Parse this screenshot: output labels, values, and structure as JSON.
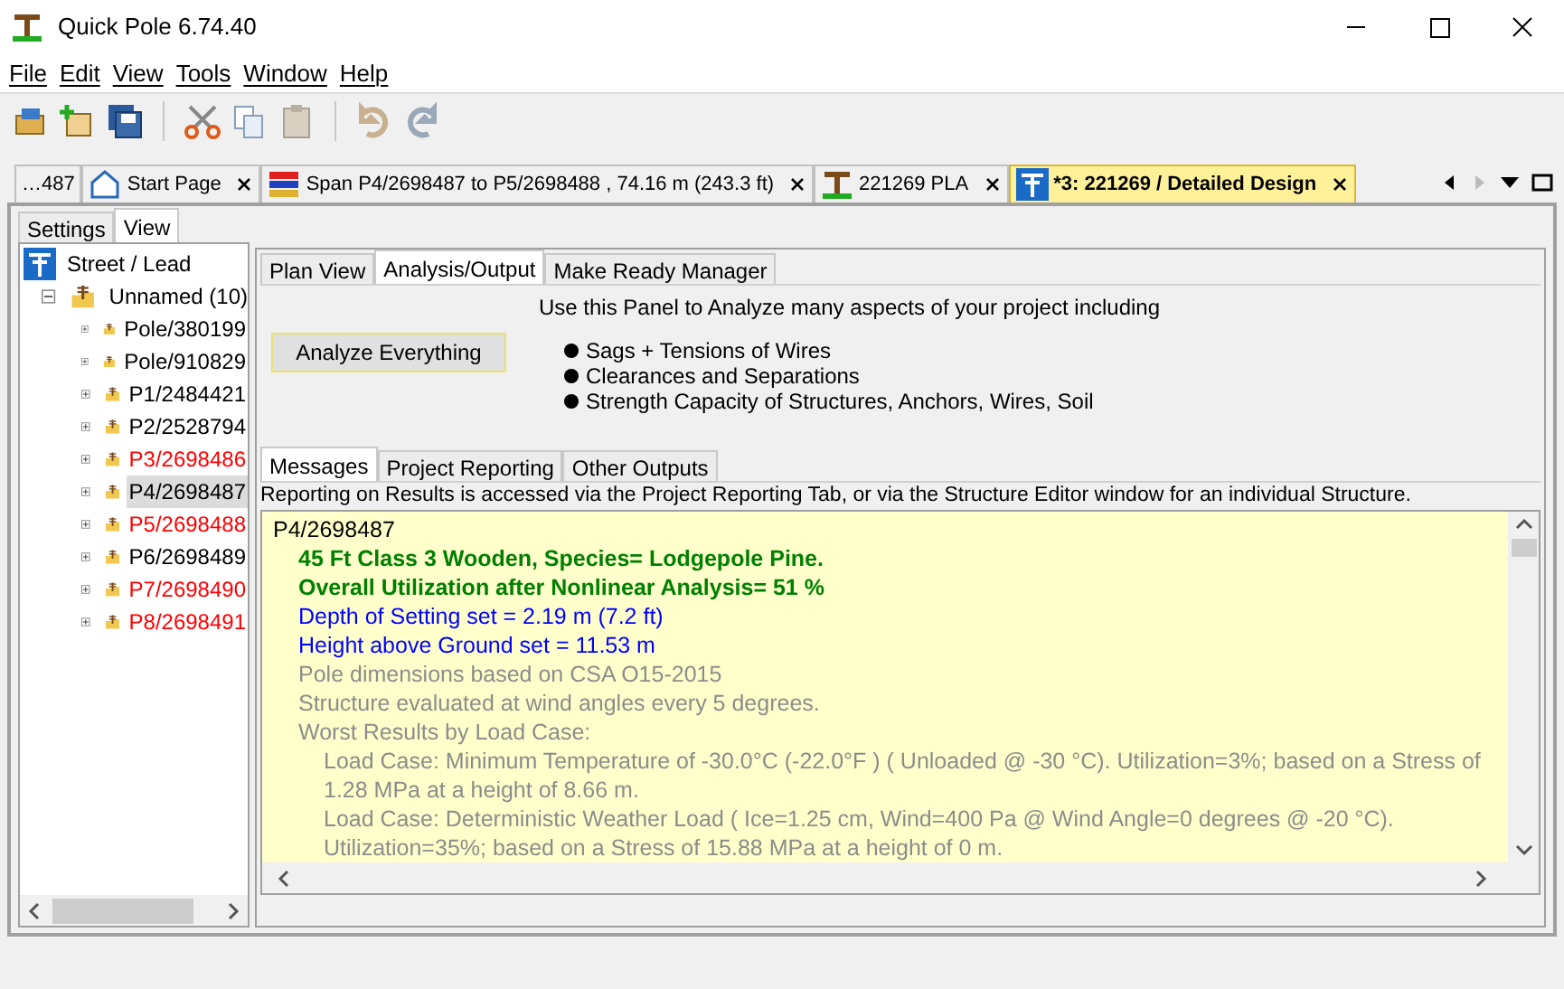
{
  "window": {
    "title": "Quick Pole 6.74.40"
  },
  "menu": [
    "File",
    "Edit",
    "View",
    "Tools",
    "Window",
    "Help"
  ],
  "doc_tabs": [
    {
      "label": "…487",
      "selected": false
    },
    {
      "label": "Start Page",
      "selected": false
    },
    {
      "label": "Span P4/2698487 to P5/2698488 , 74.16 m (243.3 ft)",
      "selected": false
    },
    {
      "label": "221269 PLA",
      "selected": false
    },
    {
      "label": "*3: 221269 / Detailed Design",
      "selected": true
    }
  ],
  "side_tabs": [
    {
      "label": "Settings",
      "selected": false
    },
    {
      "label": "View",
      "selected": true
    }
  ],
  "tree": {
    "label": "Street / Lead",
    "children": [
      {
        "label": "Unnamed (10)",
        "expanded": true,
        "children": [
          {
            "label": "Pole/380199",
            "color": "#000000",
            "selected": false
          },
          {
            "label": "Pole/910829",
            "color": "#000000",
            "selected": false
          },
          {
            "label": "P1/2484421",
            "color": "#000000",
            "selected": false
          },
          {
            "label": "P2/2528794",
            "color": "#000000",
            "selected": false
          },
          {
            "label": "P3/2698486",
            "color": "#ff0000",
            "selected": false
          },
          {
            "label": "P4/2698487",
            "color": "#000000",
            "selected": true
          },
          {
            "label": "P5/2698488",
            "color": "#ff0000",
            "selected": false
          },
          {
            "label": "P6/2698489",
            "color": "#000000",
            "selected": false
          },
          {
            "label": "P7/2698490",
            "color": "#ff0000",
            "selected": false
          },
          {
            "label": "P8/2698491",
            "color": "#ff0000",
            "selected": false
          }
        ]
      }
    ]
  },
  "main_tabs": [
    {
      "label": "Plan View",
      "selected": false
    },
    {
      "label": "Analysis/Output",
      "selected": true
    },
    {
      "label": "Make Ready Manager",
      "selected": false
    }
  ],
  "analysis": {
    "intro": "Use this Panel to Analyze many aspects of your project including",
    "button": "Analyze Everything",
    "bullets": [
      "Sags + Tensions of Wires",
      "Clearances and Separations",
      "Strength Capacity of Structures, Anchors, Wires, Soil"
    ]
  },
  "output_tabs": [
    {
      "label": "Messages",
      "selected": true
    },
    {
      "label": "Project Reporting",
      "selected": false
    },
    {
      "label": "Other Outputs",
      "selected": false
    }
  ],
  "reporting_note": "Reporting on Results is accessed via the Project Reporting Tab, or via the Structure Editor window for an individual Structure.",
  "messages": [
    {
      "kind": "heading",
      "text": "P4/2698487"
    },
    {
      "kind": "result",
      "text": "45 Ft Class 3 Wooden, Species= Lodgepole Pine."
    },
    {
      "kind": "result",
      "text": "Overall Utilization after Nonlinear Analysis= 51 %"
    },
    {
      "kind": "setting",
      "text": "Depth of Setting set = 2.19 m (7.2 ft)"
    },
    {
      "kind": "setting",
      "text": "Height above Ground set = 11.53 m"
    },
    {
      "kind": "info",
      "text": "Pole dimensions based on CSA O15-2015"
    },
    {
      "kind": "info",
      "text": "Structure evaluated at wind angles every 5 degrees."
    },
    {
      "kind": "info",
      "text": "Worst Results by Load Case:"
    },
    {
      "kind": "case",
      "text": "Load Case: Minimum Temperature of -30.0°C (-22.0°F ) ( Unloaded @ -30 °C). Utilization=3%; based on a Stress of 1.28 MPa at a height of 8.66 m."
    },
    {
      "kind": "case",
      "text": "Load Case: Deterministic Weather Load ( Ice=1.25 cm, Wind=400 Pa @ Wind Angle=0 degrees @ -20 °C). Utilization=35%; based on a Stress of 15.88 MPa at a height of 0 m."
    }
  ]
}
